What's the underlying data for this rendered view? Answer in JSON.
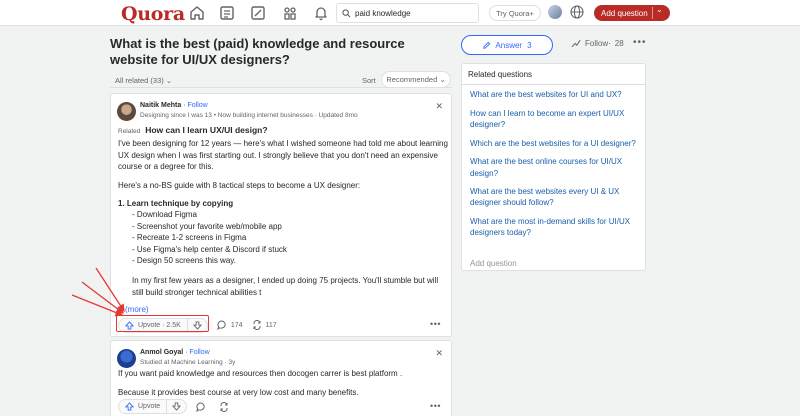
{
  "header": {
    "logo": "Quora",
    "search_value": "paid knowledge",
    "try_label": "Try Quora+",
    "add_question_label": "Add question"
  },
  "question": {
    "title": "What is the best (paid) knowledge and resource website for UI/UX designers?",
    "answer_label": "Answer",
    "answer_count": "3",
    "follow_label": "Follow",
    "follow_count": "28",
    "filter_label": "All related (33)",
    "sort_label": "Sort",
    "sort_value": "Recommended"
  },
  "answers": [
    {
      "author": "Naitik Mehta",
      "follow": "Follow",
      "credential": "Designing since I was 13 • Now building internet businesses · Updated 8mo",
      "related_label": "Related",
      "related_question": "How can I learn UX/UI design?",
      "p1": "I've been designing for 12 years — here's what I wished someone had told me about learning UX design when I was first starting out. I strongly believe that you don't need an expensive course or a degree for this.",
      "p2": "Here's a no-BS guide with 8 tactical steps to become a UX designer:",
      "list_title": "1. Learn technique by copying",
      "list_items": [
        "- Download Figma",
        "- Screenshot your favorite web/mobile app",
        "- Recreate 1-2 screens in Figma",
        "- Use Figma's help center & Discord if stuck",
        "- Design 50 screens this way."
      ],
      "p3": "In my first few years as a designer, I ended up doing 75 projects. You'll stumble but will still build stronger technical abilities t",
      "more": "(more)",
      "upvote": "Upvote · 2.5K",
      "comments": "174",
      "shares": "117"
    },
    {
      "author": "Anmol Goyal",
      "follow": "Follow",
      "credential": "Studied at Machine Learning · 3y",
      "p1": "If you want paid knowledge and resources then docogen carrer is best platform .",
      "p2": "Because it provides best course at very low cost and many benefits.",
      "upvote": "Upvote"
    }
  ],
  "sidebar": {
    "title": "Related questions",
    "items": [
      "What are the best websites for UI and UX?",
      "How can I learn to become an expert UI/UX designer?",
      "Which are the best websites for a UI designer?",
      "What are the best online courses for UI/UX design?",
      "What are the best websites every UI & UX designer should follow?",
      "What are the most in-demand skills for UI/UX designers today?"
    ],
    "add_question": "Add question"
  },
  "colors": {
    "brand": "#b92b27",
    "link": "#2e69ff",
    "related_link": "#195faa",
    "annotation": "#e53935"
  }
}
